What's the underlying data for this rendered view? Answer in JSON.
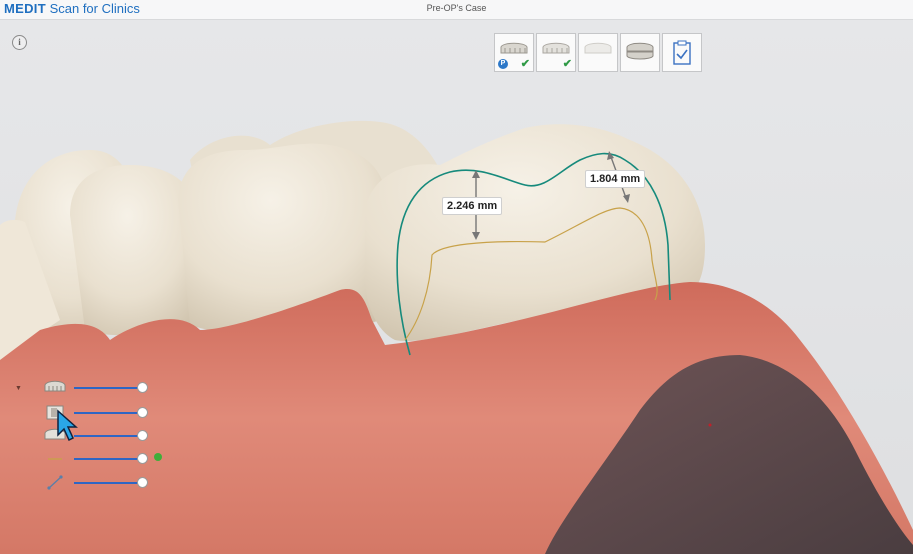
{
  "app": {
    "brand_main": "MEDIT",
    "brand_sub": "Scan for Clinics",
    "case_title": "Pre-OP's Case"
  },
  "toolbar": {
    "info_icon": "i",
    "stages": [
      {
        "name": "preop-maxilla",
        "icon": "upper-arch-icon",
        "badge": "P",
        "status": "complete"
      },
      {
        "name": "preop-mandible",
        "icon": "lower-arch-icon",
        "status": "complete"
      },
      {
        "name": "prep",
        "icon": "arch-icon",
        "status": "inactive"
      },
      {
        "name": "occlusion",
        "icon": "occlusion-icon",
        "status": ""
      },
      {
        "name": "review",
        "icon": "clipboard-check-icon",
        "status": ""
      }
    ],
    "check_mark": "✔"
  },
  "measurements": [
    {
      "label": "2.246 mm"
    },
    {
      "label": "1.804 mm"
    }
  ],
  "layer_panel": {
    "collapse_icon": "▼",
    "sliders": [
      {
        "name": "pre-op-layer",
        "icon": "teeth-model-icon",
        "value": 1.0
      },
      {
        "name": "prep-layer",
        "icon": "tooth-cut-icon",
        "value": 1.0
      },
      {
        "name": "antagonist-layer",
        "icon": "teeth-layer-icon",
        "value": 1.0
      },
      {
        "name": "margin-line-layer",
        "icon": "line-icon",
        "value": 1.0,
        "indicator_color": "#3fae3a"
      },
      {
        "name": "measure-layer",
        "icon": "ruler-line-icon",
        "value": 1.0
      }
    ]
  },
  "colors": {
    "brand": "#1f6fc0",
    "slider": "#2e66c4",
    "margin_line": "#168a7c",
    "prep_line": "#c8a24a",
    "gum": "#d97d6a"
  }
}
